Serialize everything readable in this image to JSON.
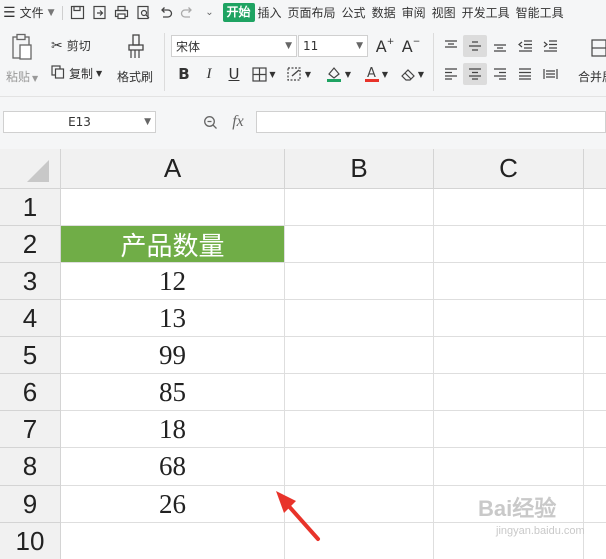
{
  "menubar": {
    "file_label": "文件",
    "tabs": [
      "开始",
      "插入",
      "页面布局",
      "公式",
      "数据",
      "审阅",
      "视图",
      "开发工具",
      "智能工具"
    ]
  },
  "ribbon": {
    "paste_label": "粘贴",
    "cut_label": "剪切",
    "copy_label": "复制",
    "format_painter_label": "格式刷",
    "font_name": "宋体",
    "font_size": "11",
    "merge_label": "合并居"
  },
  "formula_bar": {
    "name_box": "E13",
    "fx_label": "fx",
    "formula_value": ""
  },
  "sheet": {
    "columns": [
      "A",
      "B",
      "C"
    ],
    "rows": [
      "1",
      "2",
      "3",
      "4",
      "5",
      "6",
      "7",
      "8",
      "9",
      "10"
    ],
    "cells_a": [
      "",
      "产品数量",
      "12",
      "13",
      "99",
      "85",
      "18",
      "68",
      "26",
      ""
    ],
    "header_color": "#70ad47"
  },
  "watermark": {
    "brand": "Bai经验",
    "url": "jingyan.baidu.com"
  },
  "colors": {
    "accent": "#1ea362",
    "arrow": "#e8332a"
  }
}
